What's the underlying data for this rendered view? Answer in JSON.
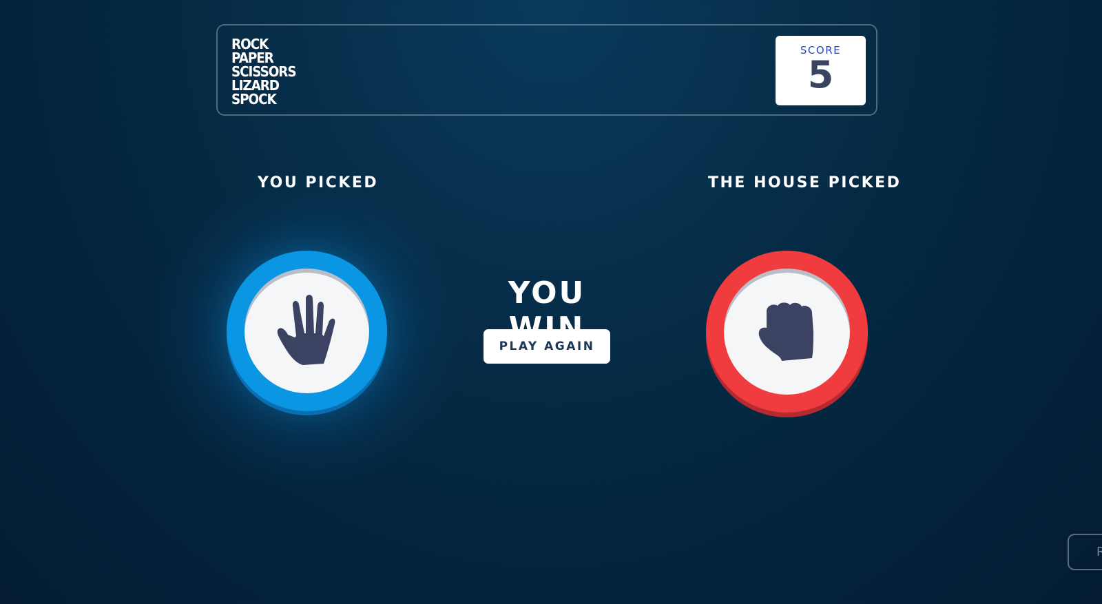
{
  "header": {
    "title_lines": [
      "ROCK",
      "PAPER",
      "SCISSORS",
      "LIZARD",
      "SPOCK"
    ],
    "score_label": "SCORE",
    "score_value": "5"
  },
  "game": {
    "you_label": "YOU PICKED",
    "house_label": "THE HOUSE PICKED",
    "you_pick": "paper",
    "house_pick": "rock",
    "result_text": "YOU WIN",
    "play_again_label": "PLAY AGAIN"
  },
  "footer": {
    "rules_label": "R"
  },
  "colors": {
    "paper_ring": "#0a96e3",
    "rock_ring": "#f13c3f",
    "icon_fill": "#3b4262",
    "score_label": "#2a46c0",
    "score_value": "#3b4363"
  }
}
